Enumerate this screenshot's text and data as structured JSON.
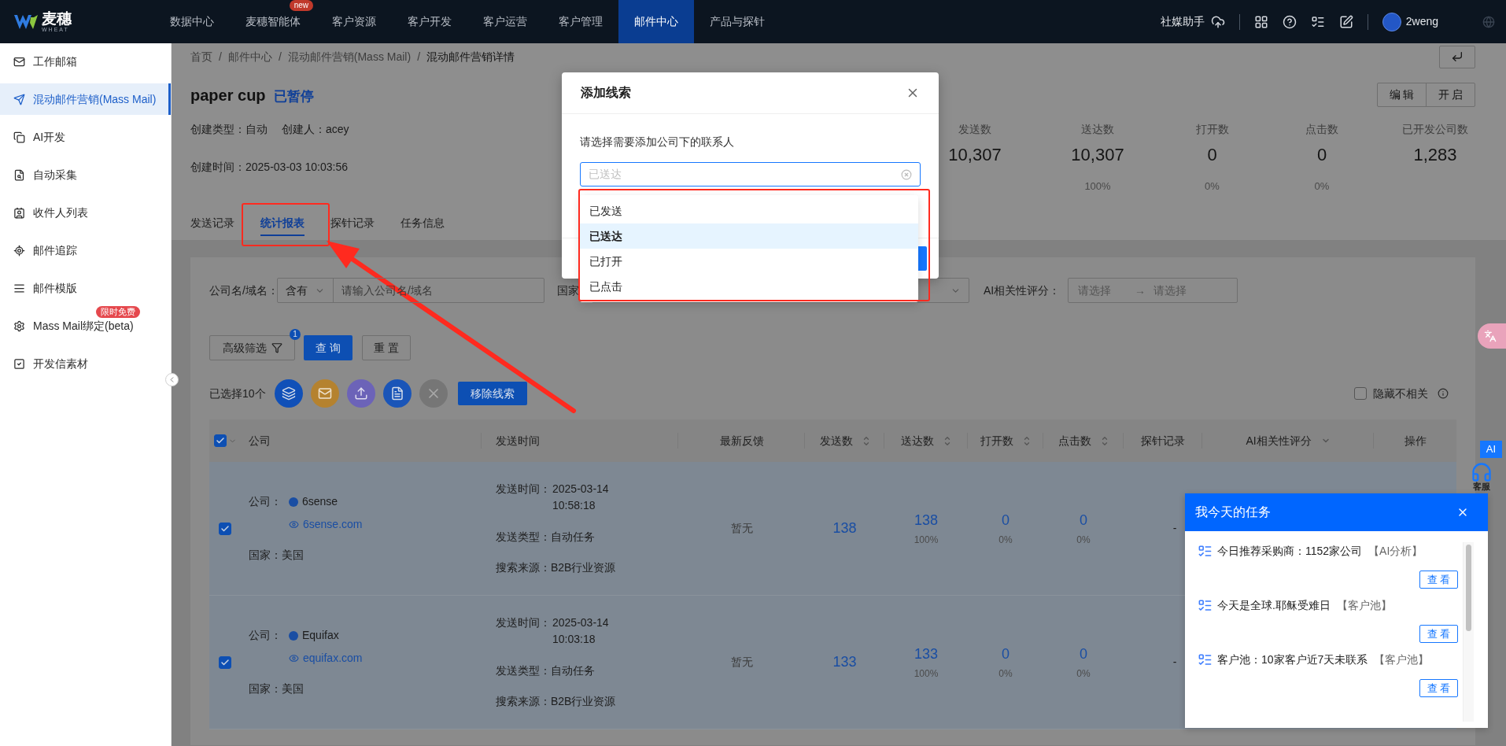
{
  "top_nav": {
    "logo": {
      "name": "麦穗",
      "subtitle": "WHEAT"
    },
    "items": [
      {
        "label": "数据中心",
        "selected": false
      },
      {
        "label": "麦穗智能体",
        "selected": false,
        "badge": "new"
      },
      {
        "label": "客户资源",
        "selected": false
      },
      {
        "label": "客户开发",
        "selected": false
      },
      {
        "label": "客户运营",
        "selected": false
      },
      {
        "label": "客户管理",
        "selected": false
      },
      {
        "label": "邮件中心",
        "selected": true
      },
      {
        "label": "产品与探针",
        "selected": false
      }
    ],
    "assistant": "社媒助手",
    "user": "2weng"
  },
  "sidebar": {
    "items": [
      {
        "label": "工作邮箱",
        "selected": false
      },
      {
        "label": "混动邮件营销(Mass Mail)",
        "selected": true
      },
      {
        "label": "AI开发",
        "selected": false
      },
      {
        "label": "自动采集",
        "selected": false
      },
      {
        "label": "收件人列表",
        "selected": false
      },
      {
        "label": "邮件追踪",
        "selected": false
      },
      {
        "label": "邮件模版",
        "selected": false
      },
      {
        "label": "Mass Mail绑定(beta)",
        "selected": false,
        "badge": "限时免费"
      },
      {
        "label": "开发信素材",
        "selected": false
      }
    ]
  },
  "breadcrumb": {
    "separator": "/",
    "items": [
      "首页",
      "邮件中心",
      "混动邮件营销(Mass Mail)",
      "混动邮件营销详情"
    ]
  },
  "campaign": {
    "title": "paper cup",
    "status": "已暂停",
    "meta": [
      "创建类型：自动",
      "创建人：acey"
    ],
    "created": "创建时间：2025-03-03 10:03:56",
    "buttons": [
      "编 辑",
      "开 启"
    ]
  },
  "stats": [
    {
      "label": "发送数",
      "value": "10,307"
    },
    {
      "label": "送达数",
      "value": "10,307",
      "percent": "100%"
    },
    {
      "label": "打开数",
      "value": "0",
      "percent": "0%"
    },
    {
      "label": "点击数",
      "value": "0",
      "percent": "0%"
    },
    {
      "label": "已开发公司数",
      "value": "1,283"
    }
  ],
  "tabs": [
    {
      "label": "发送记录",
      "selected": false
    },
    {
      "label": "统计报表",
      "selected": true
    },
    {
      "label": "探针记录",
      "selected": false
    },
    {
      "label": "任务信息",
      "selected": false
    }
  ],
  "filters": {
    "company": {
      "label": "公司名/域名：",
      "mode": "含有",
      "placeholder": "请输入公司名/域名"
    },
    "country": {
      "label": "国家"
    },
    "ai_score": {
      "label": "AI相关性评分：",
      "from_placeholder": "请选择",
      "separator": "→",
      "to_placeholder": "请选择"
    }
  },
  "filter_buttons": {
    "advanced": "高级筛选",
    "advanced_count": "1",
    "query": "查 询",
    "reset": "重 置"
  },
  "selection": {
    "summary": "已选择10个",
    "remove": "移除线索",
    "hide_irrelevant": {
      "label": "隐藏不相关",
      "checked": false
    }
  },
  "table": {
    "all_checked": true,
    "columns": [
      {
        "label": "公司",
        "sortable": false,
        "dropdown": false
      },
      {
        "label": "发送时间",
        "sortable": false,
        "dropdown": false
      },
      {
        "label": "最新反馈",
        "sortable": false,
        "dropdown": false
      },
      {
        "label": "发送数",
        "sortable": true,
        "dropdown": false
      },
      {
        "label": "送达数",
        "sortable": true,
        "dropdown": false
      },
      {
        "label": "打开数",
        "sortable": true,
        "dropdown": false
      },
      {
        "label": "点击数",
        "sortable": true,
        "dropdown": false
      },
      {
        "label": "探针记录",
        "sortable": false,
        "dropdown": false
      },
      {
        "label": "AI相关性评分",
        "sortable": false,
        "dropdown": true
      },
      {
        "label": "操作",
        "sortable": false,
        "dropdown": false
      }
    ],
    "rows": [
      {
        "checked": true,
        "company_label": "公司：",
        "company": "6sense",
        "domain": "6sense.com",
        "country": "国家：美国",
        "send_time_label": "发送时间：",
        "send_time": "2025-03-14 10:58:18",
        "send_type": "发送类型：自动任务",
        "source": "搜索来源：B2B行业资源",
        "feedback": "暂无",
        "sent": "138",
        "delivered": "138",
        "delivered_rate": "100%",
        "opened": "0",
        "opened_rate": "0%",
        "clicked": "0",
        "clicked_rate": "0%",
        "probe": "-"
      },
      {
        "checked": true,
        "company_label": "公司：",
        "company": "Equifax",
        "domain": "equifax.com",
        "country": "国家：美国",
        "send_time_label": "发送时间：",
        "send_time": "2025-03-14 10:03:18",
        "send_type": "发送类型：自动任务",
        "source": "搜索来源：B2B行业资源",
        "feedback": "暂无",
        "sent": "133",
        "delivered": "133",
        "delivered_rate": "100%",
        "opened": "0",
        "opened_rate": "0%",
        "clicked": "0",
        "clicked_rate": "0%",
        "probe": "-"
      }
    ]
  },
  "dialog": {
    "title": "添加线索",
    "prompt": "请选择需要添加公司下的联系人",
    "placeholder": "已送达",
    "options": [
      {
        "label": "已发送",
        "selected": false
      },
      {
        "label": "已送达",
        "selected": true
      },
      {
        "label": "已打开",
        "selected": false
      },
      {
        "label": "已点击",
        "selected": false
      }
    ]
  },
  "task_panel": {
    "title": "我今天的任务",
    "items": [
      {
        "text": "今日推荐采购商：1152家公司",
        "tag": "【AI分析】",
        "button": "查 看"
      },
      {
        "text": "今天是全球.耶稣受难日",
        "tag": "【客户池】",
        "button": "查 看"
      },
      {
        "text": "客户池：10家客户近7天未联系",
        "tag": "【客户池】",
        "button": "查 看"
      }
    ]
  },
  "floating": {
    "ai": "AI",
    "service": "客服"
  },
  "annotations": [
    {
      "kind": "box"
    },
    {
      "kind": "box"
    },
    {
      "kind": "arrow"
    }
  ]
}
